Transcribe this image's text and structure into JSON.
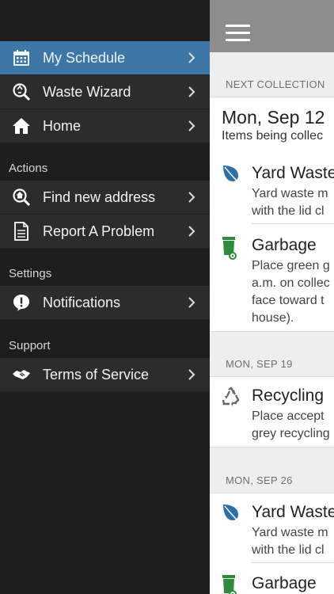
{
  "sidebar": {
    "items_top": [
      {
        "label": "My Schedule",
        "icon": "calendar-icon",
        "active": true
      },
      {
        "label": "Waste Wizard",
        "icon": "waste-wizard-icon"
      },
      {
        "label": "Home",
        "icon": "home-icon"
      }
    ],
    "actions_header": "Actions",
    "actions": [
      {
        "label": "Find new address",
        "icon": "find-address-icon"
      },
      {
        "label": "Report A Problem",
        "icon": "document-icon"
      }
    ],
    "settings_header": "Settings",
    "settings": [
      {
        "label": "Notifications",
        "icon": "alert-icon"
      }
    ],
    "support_header": "Support",
    "support": [
      {
        "label": "Terms of Service",
        "icon": "handshake-icon"
      }
    ]
  },
  "schedule": {
    "next_collection_header": "NEXT COLLECTION",
    "first_card": {
      "date": "Mon, Sep 12",
      "subtitle": "Items being collec",
      "items": [
        {
          "title": "Yard Waste",
          "desc": "Yard waste m\nwith the lid cl",
          "icon": "leaf-icon"
        },
        {
          "title": "Garbage",
          "desc": "Place green g\na.m. on collec\nface toward t\nhouse).",
          "icon": "garbage-cart-icon"
        }
      ]
    },
    "second_header": "MON, SEP 19",
    "second_card": {
      "items": [
        {
          "title": "Recycling",
          "desc": "Place accept\ngrey recycling",
          "icon": "recycle-icon"
        }
      ]
    },
    "third_header": "MON, SEP 26",
    "third_card": {
      "items": [
        {
          "title": "Yard Waste",
          "desc": "Yard waste m\nwith the lid cl",
          "icon": "leaf-icon"
        },
        {
          "title": "Garbage",
          "desc": "",
          "icon": "garbage-cart-icon"
        }
      ]
    }
  },
  "colors": {
    "sidebar_bg": "#1e1e1e",
    "menu_item_bg": "#2c2c2c",
    "active_bg": "#3d77a8",
    "topbar_bg": "#8d8d8d",
    "leaf_blue": "#2d6fa8",
    "garbage_green": "#2e8b3a"
  }
}
